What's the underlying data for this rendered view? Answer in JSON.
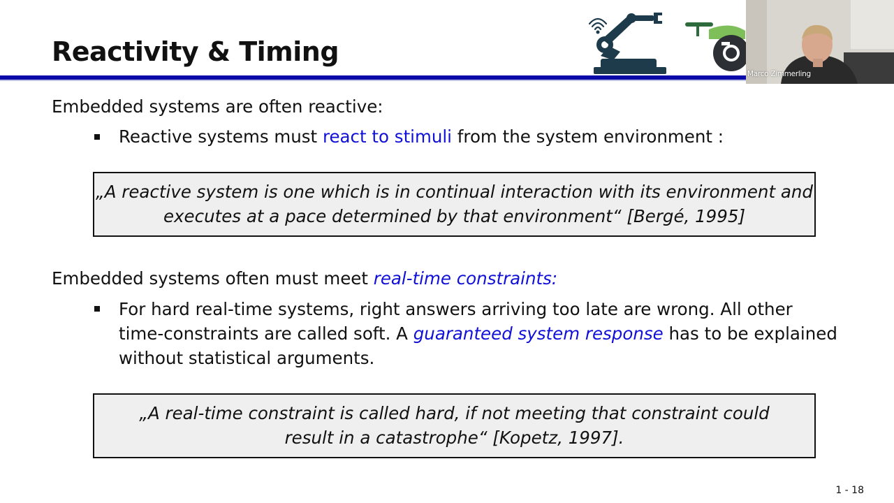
{
  "slide": {
    "title": "Reactivity & Timing",
    "heading1": "Embedded systems are often reactive:",
    "bullet1": {
      "before": "Reactive systems must ",
      "highlight": "react to stimuli",
      "after": " from the system environment :"
    },
    "quote1": {
      "line1": "„A reactive system is one which is in continual interaction with its environment and",
      "line2": "executes at a pace determined by that environment“ [Bergé, 1995]"
    },
    "heading2": {
      "before": "Embedded systems often must meet ",
      "highlight": "real-time constraints",
      "after": ":"
    },
    "bullet2": {
      "line1": "For hard real-time systems, right answers arriving too late are wrong. All other",
      "line2_before": "time-constraints are called soft. A ",
      "line2_highlight": "guaranteed system response",
      "line2_after": " has to be explained",
      "line3": "without statistical arguments."
    },
    "quote2": {
      "line1": "„A real-time constraint is called hard, if not meeting that constraint could",
      "line2": "result in a catastrophe“ [Kopetz, 1997]."
    },
    "page_number": "1 - 18",
    "logo_icon": "robot-arm-icon",
    "logo2_icon": "camera-drone-icon"
  },
  "webcam": {
    "presenter_name": "Marco Zimmerling"
  },
  "colors": {
    "accent_blue": "#0a0aa8",
    "highlight_blue": "#1010d8",
    "quote_bg": "#efefef"
  }
}
